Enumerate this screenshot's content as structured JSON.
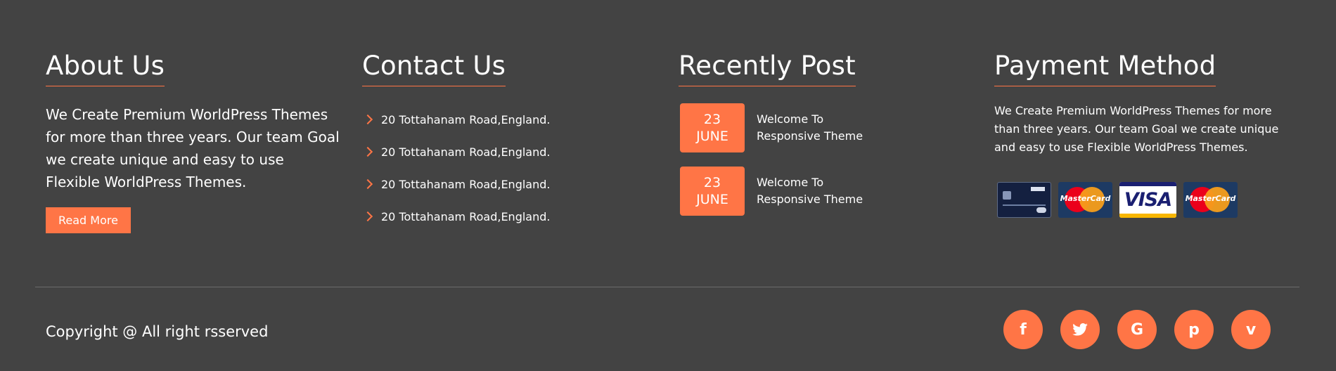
{
  "about": {
    "heading": "About Us",
    "text": "We Create Premium WorldPress Themes for more than three years. Our team Goal we create unique and easy to use Flexible WorldPress Themes.",
    "button_label": "Read More"
  },
  "contact": {
    "heading": "Contact Us",
    "items": [
      "20 Tottahanam Road,England.",
      "20 Tottahanam Road,England.",
      "20 Tottahanam Road,England.",
      "20 Tottahanam Road,England."
    ]
  },
  "recent": {
    "heading": "Recently Post",
    "posts": [
      {
        "day": "23",
        "month": "JUNE",
        "title": "Welcome To Responsive Theme"
      },
      {
        "day": "23",
        "month": "JUNE",
        "title": "Welcome To Responsive Theme"
      }
    ]
  },
  "payment": {
    "heading": "Payment Method",
    "text": "We Create Premium WorldPress Themes for more than three years. Our team Goal we create unique and easy to use Flexible WorldPress Themes.",
    "cards": [
      {
        "icon": "bank-card-icon"
      },
      {
        "icon": "mastercard-icon",
        "label": "MasterCard"
      },
      {
        "icon": "visa-icon",
        "label": "VISA"
      },
      {
        "icon": "mastercard-icon",
        "label": "MasterCard"
      }
    ]
  },
  "bottom": {
    "copyright": "Copyright @ All right rsserved",
    "socials": [
      {
        "icon": "facebook-icon",
        "glyph": "f"
      },
      {
        "icon": "twitter-icon"
      },
      {
        "icon": "google-icon",
        "glyph": "G"
      },
      {
        "icon": "pinterest-icon",
        "glyph": "p"
      },
      {
        "icon": "vimeo-icon",
        "glyph": "v"
      }
    ]
  },
  "colors": {
    "background": "#434343",
    "accent": "#ff7546",
    "text": "#ffffff"
  }
}
